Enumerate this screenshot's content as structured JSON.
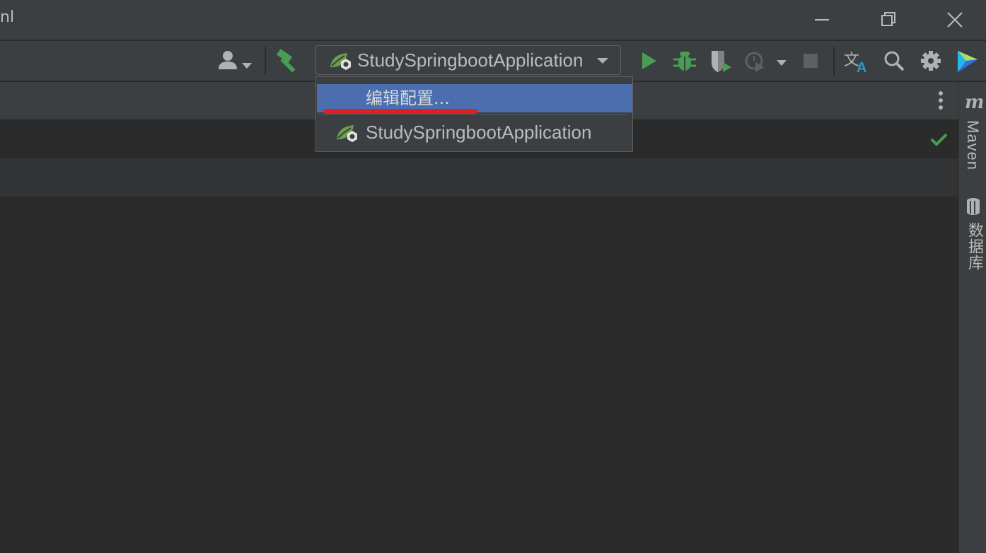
{
  "window": {
    "title_fragment": "nl"
  },
  "toolbar": {
    "run_config_label": "StudySpringbootApplication",
    "icons": [
      "user-icon",
      "build-hammer-icon",
      "run-icon",
      "debug-icon",
      "coverage-icon",
      "profile-icon",
      "stop-icon",
      "translate-icon",
      "search-icon",
      "settings-icon",
      "plugin-logo-icon"
    ]
  },
  "dropdown": {
    "items": [
      {
        "label": "编辑配置...",
        "selected": true
      },
      {
        "label": "StudySpringbootApplication",
        "selected": false
      }
    ]
  },
  "right_sidebar": {
    "maven_icon_text": "m",
    "maven_label": "Maven",
    "database_label": "数据库"
  },
  "colors": {
    "accent_selection": "#4b6eaf",
    "run_green": "#499c54",
    "annotation_red": "#e01e26"
  }
}
